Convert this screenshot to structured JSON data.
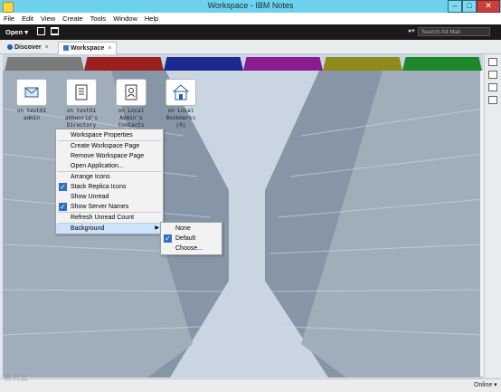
{
  "window": {
    "title": "Workspace - IBM Notes"
  },
  "menu": [
    "File",
    "Edit",
    "View",
    "Create",
    "Tools",
    "Window",
    "Help"
  ],
  "toolbar": {
    "open_label": "Open ▾",
    "search_placeholder": "Search All Mail"
  },
  "tabs": [
    {
      "label": "Discover",
      "icon": "info-icon",
      "active": false
    },
    {
      "label": "Workspace",
      "icon": "grid-icon",
      "active": true
    }
  ],
  "page_tab_colors": [
    "#7a7a7a",
    "#9a1f1f",
    "#1c2a8f",
    "#8a1c8f",
    "#8f8a1c",
    "#1c8a2a"
  ],
  "databases": [
    {
      "icon": "mail-icon",
      "line1": "on test01",
      "line2": "admin",
      "line3": ""
    },
    {
      "icon": "book-icon",
      "line1": "on test01",
      "line2": "abbworld's",
      "line3": "Directory"
    },
    {
      "icon": "contacts-icon",
      "line1": "on Local",
      "line2": "Admin's",
      "line3": "Contacts"
    },
    {
      "icon": "home-icon",
      "line1": "on Local",
      "line2": "Bookmarks",
      "line3": "(0)"
    }
  ],
  "context_menu": {
    "items": [
      {
        "label": "Workspace Properties",
        "checked": false
      },
      {
        "label": "Create Workspace Page",
        "checked": false
      },
      {
        "label": "Remove Workspace Page",
        "checked": false
      },
      {
        "label": "Open Application...",
        "checked": false
      },
      {
        "label": "Arrange Icons",
        "checked": false
      },
      {
        "label": "Stack Replica Icons",
        "checked": true
      },
      {
        "label": "Show Unread",
        "checked": false
      },
      {
        "label": "Show Server Names",
        "checked": true
      },
      {
        "label": "Refresh Unread Count",
        "checked": false
      },
      {
        "label": "Background",
        "checked": false
      }
    ]
  },
  "submenu": {
    "items": [
      {
        "label": "None",
        "checked": false
      },
      {
        "label": "Default",
        "checked": true
      },
      {
        "label": "Choose...",
        "checked": false
      }
    ]
  },
  "status": {
    "online_label": "Online ▾",
    "watermark": "易讯云"
  }
}
